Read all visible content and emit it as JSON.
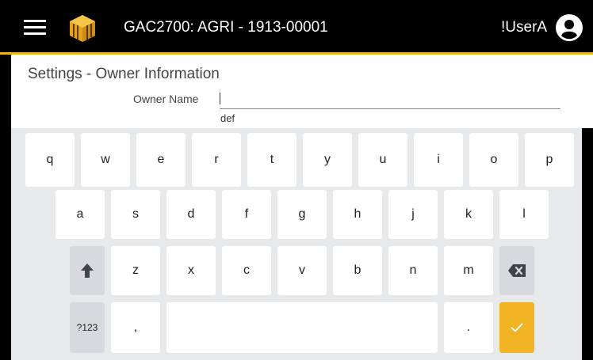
{
  "header": {
    "title": "GAC2700: AGRI - 1913-00001",
    "user": "!UserA",
    "menu_icon": "hamburger-menu-icon",
    "logo_icon": "gold-striped-cube-logo",
    "avatar_icon": "user-circle-icon",
    "accent_color": "#f0b323"
  },
  "page": {
    "title": "Settings - Owner Information",
    "owner_name_label": "Owner Name",
    "owner_name_value": "",
    "suggestion": "def"
  },
  "keyboard": {
    "row1": [
      "q",
      "w",
      "e",
      "r",
      "t",
      "y",
      "u",
      "i",
      "o",
      "p"
    ],
    "row2": [
      "a",
      "s",
      "d",
      "f",
      "g",
      "h",
      "j",
      "k",
      "l"
    ],
    "row3": [
      "z",
      "x",
      "c",
      "v",
      "b",
      "n",
      "m"
    ],
    "symbols_label": "?123",
    "comma": ",",
    "period": ".",
    "shift_icon": "shift-up-arrow-icon",
    "backspace_icon": "backspace-icon",
    "enter_icon": "checkmark-icon",
    "enter_color": "#f0b323"
  }
}
